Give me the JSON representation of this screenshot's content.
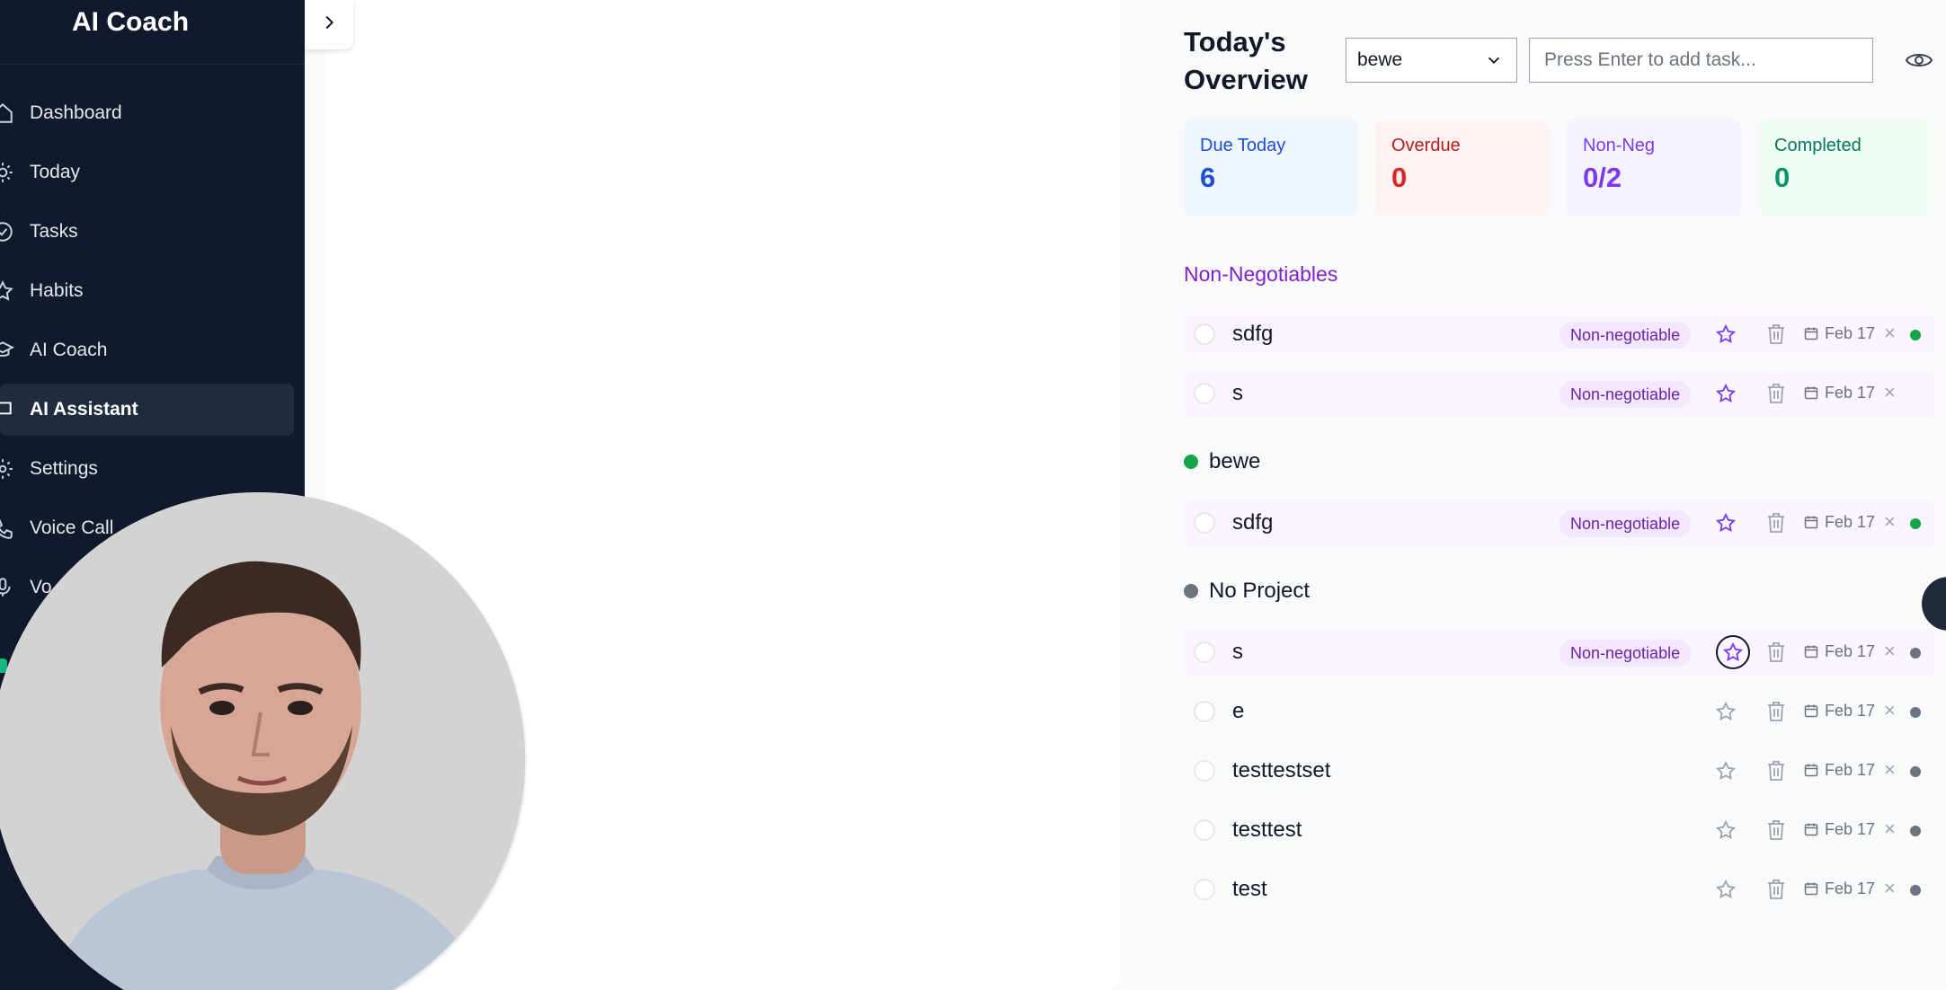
{
  "sidebar": {
    "brand": "AI Coach",
    "items": [
      {
        "label": "Dashboard",
        "icon": "home-icon"
      },
      {
        "label": "Today",
        "icon": "sun-icon"
      },
      {
        "label": "Tasks",
        "icon": "check-circle-icon"
      },
      {
        "label": "Habits",
        "icon": "star-icon"
      },
      {
        "label": "AI Coach",
        "icon": "graduation-cap-icon"
      },
      {
        "label": "AI Assistant",
        "icon": "chat-icon",
        "active": true
      },
      {
        "label": "Settings",
        "icon": "gear-icon"
      },
      {
        "label": "Voice Call",
        "icon": "phone-icon"
      },
      {
        "label": "Vo",
        "icon": "mic-icon"
      }
    ]
  },
  "header": {
    "title": "Today's Overview",
    "project_select": "bewe",
    "task_placeholder": "Press Enter to add task..."
  },
  "stats": [
    {
      "label": "Due Today",
      "value": "6",
      "color": "#1d4ed8",
      "bg": "#eff6ff"
    },
    {
      "label": "Overdue",
      "value": "0",
      "color": "#dc2626",
      "bg": "#fef2f2"
    },
    {
      "label": "Non-Neg",
      "value": "0/2",
      "color": "#7c3aed",
      "bg": "#f5f3ff"
    },
    {
      "label": "Completed",
      "value": "0",
      "color": "#059669",
      "bg": "#f0fdf4"
    }
  ],
  "sections": {
    "non_negotiables": "Non-Negotiables",
    "project_bewe": "bewe",
    "no_project": "No Project"
  },
  "badge_label": "Non-negotiable",
  "tasks": [
    {
      "name": "sdfg",
      "date": "Feb 17",
      "nn": true,
      "status": "#16a34a"
    },
    {
      "name": "s",
      "date": "Feb 17",
      "nn": true,
      "status": ""
    },
    {
      "name": "sdfg",
      "date": "Feb 17",
      "nn": true,
      "status": "#16a34a"
    },
    {
      "name": "s",
      "date": "Feb 17",
      "nn": true,
      "status": "#6b7280"
    },
    {
      "name": "e",
      "date": "Feb 17",
      "nn": false,
      "status": "#6b7280"
    },
    {
      "name": "testtestset",
      "date": "Feb 17",
      "nn": false,
      "status": "#6b7280"
    },
    {
      "name": "testtest",
      "date": "Feb 17",
      "nn": false,
      "status": "#6b7280"
    },
    {
      "name": "test",
      "date": "Feb 17",
      "nn": false,
      "status": "#6b7280"
    }
  ],
  "colors": {
    "sidebar_bg": "#111a2c",
    "accent_purple": "#7c3aed",
    "project_green": "#16a34a",
    "no_project_gray": "#6b7280"
  }
}
